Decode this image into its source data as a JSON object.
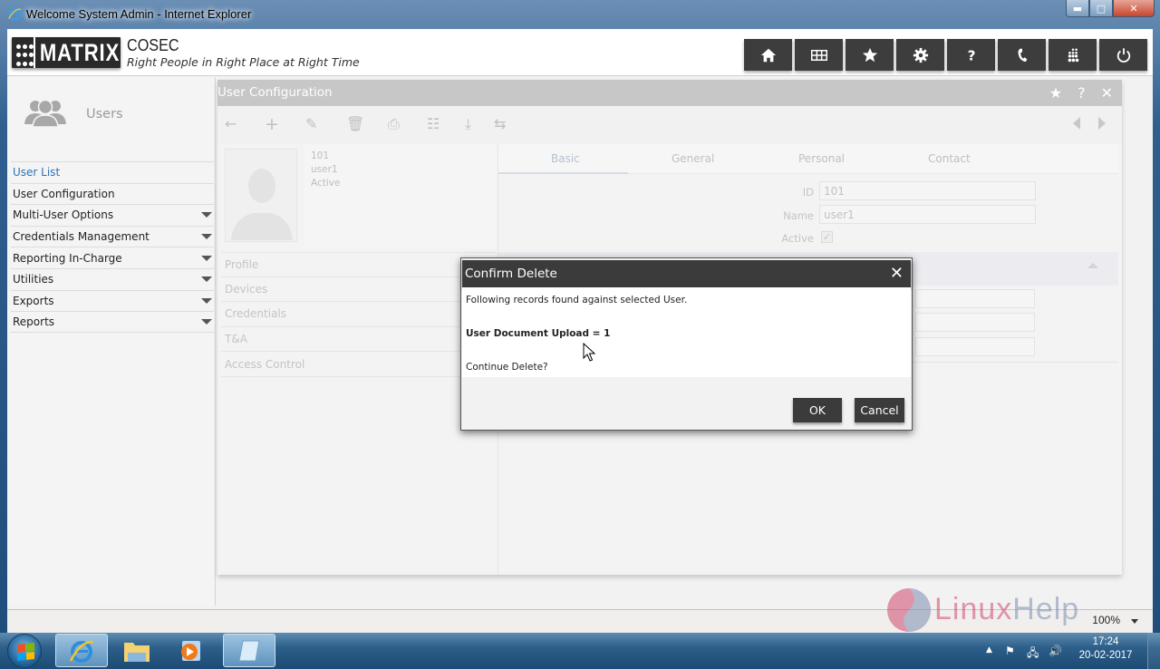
{
  "window": {
    "title": "Welcome System Admin - Internet Explorer",
    "controls": [
      "minimize",
      "maximize",
      "close"
    ]
  },
  "app_header": {
    "logo_text": "MATRIX",
    "product_name": "COSEC",
    "tagline": "Right People in Right Place at Right Time",
    "nav_buttons": [
      {
        "icon": "home-icon"
      },
      {
        "icon": "grid-icon"
      },
      {
        "icon": "star-icon"
      },
      {
        "icon": "gear-icon"
      },
      {
        "icon": "help-icon",
        "glyph": "?"
      },
      {
        "icon": "phone-icon"
      },
      {
        "icon": "matrix-dots-icon"
      },
      {
        "icon": "power-icon"
      }
    ]
  },
  "sidebar": {
    "section_title": "Users",
    "items": [
      {
        "label": "User List",
        "active": true,
        "expandable": false
      },
      {
        "label": "User Configuration",
        "active": false,
        "expandable": false
      },
      {
        "label": "Multi-User Options",
        "active": false,
        "expandable": true
      },
      {
        "label": "Credentials Management",
        "active": false,
        "expandable": true
      },
      {
        "label": "Reporting In-Charge",
        "active": false,
        "expandable": true
      },
      {
        "label": "Utilities",
        "active": false,
        "expandable": true
      },
      {
        "label": "Exports",
        "active": false,
        "expandable": true
      },
      {
        "label": "Reports",
        "active": false,
        "expandable": true
      }
    ]
  },
  "panel": {
    "title": "User Configuration",
    "title_actions": [
      "star-icon",
      "help-icon",
      "close-icon"
    ],
    "toolbar": [
      "back-icon",
      "add-icon",
      "edit-icon",
      "delete-icon",
      "save-icon",
      "clear-icon",
      "download-icon",
      "swap-icon"
    ],
    "profile": {
      "id": "101",
      "name": "user1",
      "status": "Active"
    },
    "sections": [
      "Profile",
      "Devices",
      "Credentials",
      "T&A",
      "Access Control"
    ],
    "tabs": [
      {
        "label": "Basic",
        "active": true
      },
      {
        "label": "General",
        "active": false
      },
      {
        "label": "Personal",
        "active": false
      },
      {
        "label": "Contact",
        "active": false
      }
    ],
    "fields": {
      "id_label": "ID",
      "id_value": "101",
      "name_label": "Name",
      "name_value": "user1",
      "active_label": "Active",
      "active_checked": true
    }
  },
  "dialog": {
    "title": "Confirm Delete",
    "message": "Following records found against selected User.",
    "record_line": "User Document Upload = 1",
    "question": "Continue Delete?",
    "ok_label": "OK",
    "cancel_label": "Cancel"
  },
  "ie_status": {
    "zoom": "100%"
  },
  "watermark": {
    "part1": "Linux",
    "part2": "Help"
  },
  "taskbar": {
    "apps": [
      "internet-explorer",
      "windows-explorer",
      "media-player",
      "notepad"
    ],
    "time": "17:24",
    "date": "20-02-2017"
  },
  "colors": {
    "accent_link": "#2d73b8",
    "header_button_bg": "#3d3d3d",
    "dialog_header_bg": "#3b3b3b"
  }
}
